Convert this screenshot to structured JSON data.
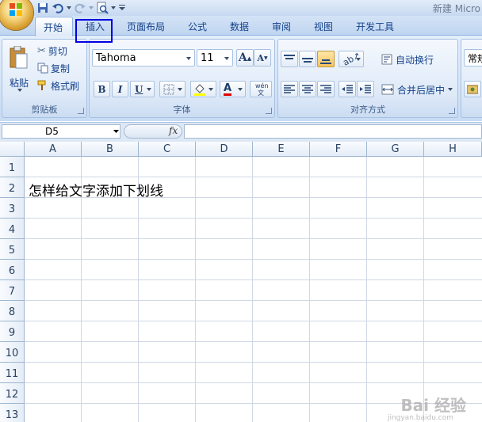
{
  "window": {
    "title": "新建 Micro"
  },
  "quick_access": {
    "icons": [
      "save-icon",
      "undo-icon",
      "redo-icon",
      "print-preview-icon",
      "customize-arrow-icon"
    ]
  },
  "tabs": [
    "开始",
    "插入",
    "页面布局",
    "公式",
    "数据",
    "审阅",
    "视图",
    "开发工具"
  ],
  "active_tab": "开始",
  "highlighted_tab": "插入",
  "ribbon": {
    "clipboard": {
      "label": "剪贴板",
      "paste": "粘贴",
      "cut": "剪切",
      "copy": "复制",
      "format_painter": "格式刷"
    },
    "font": {
      "label": "字体",
      "font_name": "Tahoma",
      "font_size": "11",
      "grow": "A",
      "shrink": "A",
      "bold": "B",
      "italic": "I",
      "underline": "U",
      "font_color_letter": "A",
      "phonetic": "wén 文"
    },
    "alignment": {
      "label": "对齐方式",
      "wrap_text": "自动换行",
      "merge_center": "合并后居中"
    },
    "number": {
      "format": "常规"
    }
  },
  "formula_bar": {
    "name_box": "D5",
    "fx": "fx",
    "value": ""
  },
  "sheet": {
    "columns": [
      "A",
      "B",
      "C",
      "D",
      "E",
      "F",
      "G",
      "H"
    ],
    "rows": [
      "1",
      "2",
      "3",
      "4",
      "5",
      "6",
      "7",
      "8",
      "9",
      "10",
      "11",
      "12",
      "13"
    ],
    "cells": {
      "A2": "怎样给文字添加下划线"
    }
  },
  "watermark": {
    "text": "Bai 经验",
    "sub": "jingyan.baidu.com"
  },
  "colors": {
    "highlight_box": "#0000e0",
    "ribbon_bg": "#dfeaf8",
    "font_color": "#e00000",
    "fill_color": "#ffff00"
  }
}
